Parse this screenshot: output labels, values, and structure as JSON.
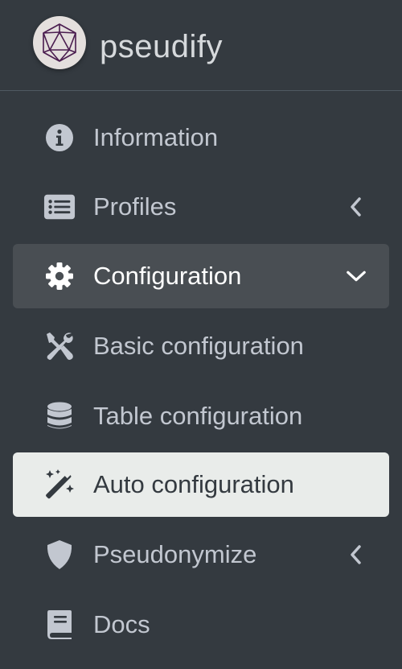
{
  "brand": {
    "name": "pseudify",
    "logo_icon": "icosahedron-logo-icon"
  },
  "colors": {
    "sidebar_bg": "#343a40",
    "item_text": "#c2c7d0",
    "open_bg": "#494e53",
    "active_bg": "#e9ecea",
    "active_text": "#343a40",
    "logo_bg": "#e4dfdd",
    "logo_stroke": "#4a1d4f"
  },
  "nav": {
    "information": {
      "label": "Information",
      "icon": "info-circle-icon"
    },
    "profiles": {
      "label": "Profiles",
      "icon": "list-alt-icon",
      "expanded": false
    },
    "configuration": {
      "label": "Configuration",
      "icon": "gear-icon",
      "expanded": true
    },
    "basic_configuration": {
      "label": "Basic configuration",
      "icon": "tools-icon"
    },
    "table_configuration": {
      "label": "Table configuration",
      "icon": "database-icon"
    },
    "auto_configuration": {
      "label": "Auto configuration",
      "icon": "magic-wand-icon",
      "active": true
    },
    "pseudonymize": {
      "label": "Pseudonymize",
      "icon": "shield-icon",
      "expanded": false
    },
    "docs": {
      "label": "Docs",
      "icon": "book-icon"
    }
  }
}
